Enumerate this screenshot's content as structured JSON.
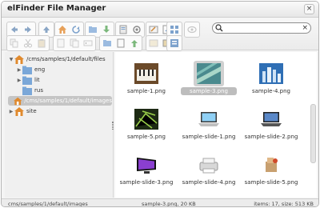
{
  "app": {
    "title": "elFinder File Manager",
    "close_glyph": "×"
  },
  "toolbar": {
    "buttons": [
      "back-icon",
      "forward-icon",
      "up-icon",
      "home-icon",
      "reload-icon",
      "open-icon",
      "download-icon",
      "get-info-icon",
      "quicklook-icon",
      "copy-icon",
      "cut-icon",
      "paste-icon",
      "remove-icon",
      "duplicate-icon",
      "rename-icon",
      "edit-icon",
      "resize-icon",
      "extract-icon",
      "archive-icon",
      "new-folder-icon",
      "new-file-icon",
      "upload-icon",
      "help-icon",
      "view-icon",
      "sort-icon"
    ]
  },
  "search": {
    "placeholder": "",
    "clear_glyph": "×"
  },
  "tree": {
    "items": [
      {
        "label": "/cms/samples/1/default/files",
        "expanded": true
      },
      {
        "label": "eng"
      },
      {
        "label": "lit"
      },
      {
        "label": "rus"
      },
      {
        "label": "/cms/samples/1/default/images",
        "selected": true
      },
      {
        "label": "site"
      }
    ]
  },
  "files": [
    {
      "name": "sample-1.png",
      "thumb": "piano"
    },
    {
      "name": "sample-3.png",
      "thumb": "waves",
      "selected": true
    },
    {
      "name": "sample-4.png",
      "thumb": "city"
    },
    {
      "name": "sample-5.png",
      "thumb": "circuit"
    },
    {
      "name": "sample-slide-1.png",
      "thumb": "laptop"
    },
    {
      "name": "sample-slide-2.png",
      "thumb": "laptop-dark"
    },
    {
      "name": "sample-slide-3.png",
      "thumb": "monitor"
    },
    {
      "name": "sample-slide-4.png",
      "thumb": "printer"
    },
    {
      "name": "sample-slide-5.png",
      "thumb": "boxes"
    }
  ],
  "status": {
    "path": "cms/samples/1/default/images",
    "selected": "sample-3.png, 20 KB",
    "totals": "items: 17, size: 513 KB"
  },
  "colors": {
    "selection": "#c5c5c5",
    "folder": "#7aa7d8",
    "home": "#e08a2e"
  }
}
